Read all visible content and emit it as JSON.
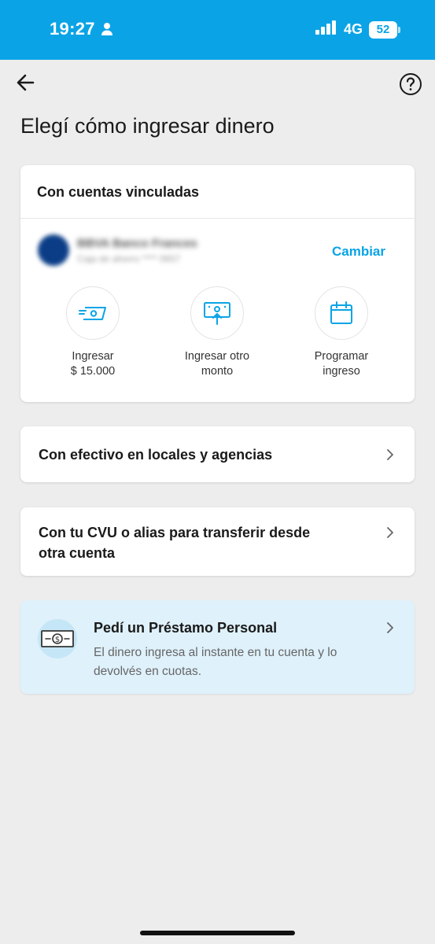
{
  "status_bar": {
    "time": "19:27",
    "network": "4G",
    "battery": "52",
    "background_color": "#0aa4e6"
  },
  "nav": {
    "back_icon": "arrow-left-icon",
    "help_icon": "question-circle-icon"
  },
  "page": {
    "title": "Elegí cómo ingresar dinero"
  },
  "linked_accounts": {
    "header": "Con cuentas vinculadas",
    "bank_name": "BBVA Banco Frances",
    "account_detail": "Caja de ahorro **** 0657",
    "change_label": "Cambiar",
    "actions": [
      {
        "label_line1": "Ingresar",
        "label_line2": "$ 15.000",
        "icon": "cash-transfer-icon"
      },
      {
        "label_line1": "Ingresar otro",
        "label_line2": "monto",
        "icon": "deposit-bill-icon"
      },
      {
        "label_line1": "Programar",
        "label_line2": "ingreso",
        "icon": "calendar-icon"
      }
    ]
  },
  "options": {
    "cash": "Con efectivo en locales y agencias",
    "cvu_line1": "Con tu CVU o alias para transferir desde",
    "cvu_line2": "otra cuenta"
  },
  "loan": {
    "title": "Pedí un Préstamo Personal",
    "description": "El dinero ingresa al instante en tu cuenta y lo devolvés en cuotas.",
    "icon": "money-bill-icon"
  },
  "colors": {
    "accent": "#0aa4e6",
    "loan_background": "#dff1fb",
    "page_background": "#ededed"
  }
}
